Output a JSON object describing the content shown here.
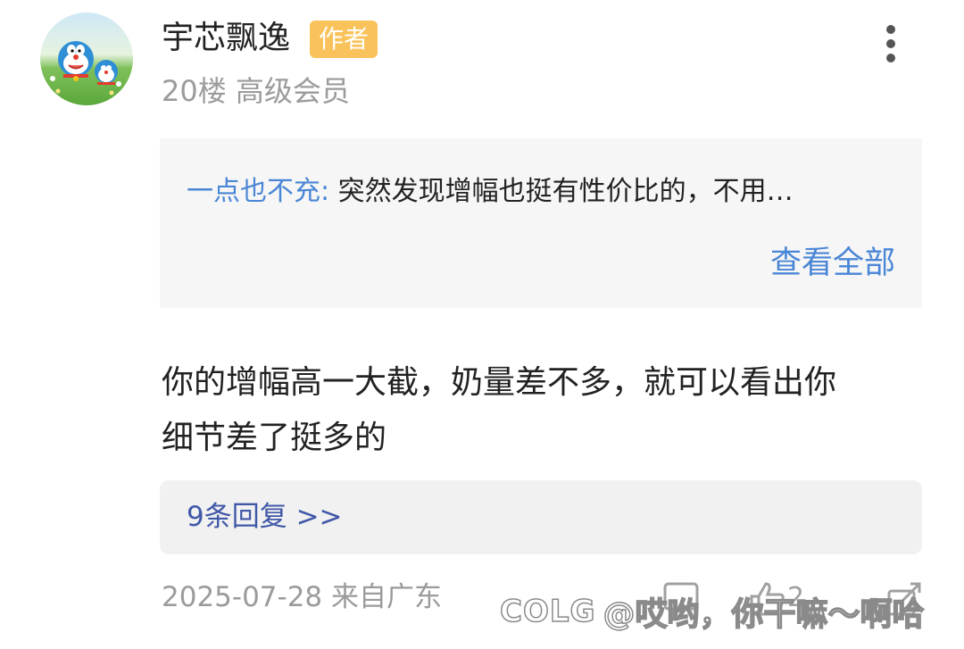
{
  "post": {
    "username": "宇芯飘逸",
    "author_badge": "作者",
    "floor": "20楼",
    "member_level": "高级会员",
    "quote": {
      "author": "一点也不充:",
      "text": " 突然发现增幅也挺有性价比的，不用…",
      "view_all_label": "查看全部"
    },
    "comment_line1": "你的增幅高一大截，奶量差不多，就可以看出你",
    "comment_line2": "细节差了挺多的",
    "replies_label": "9条回复 >>",
    "date": "2025-07-28",
    "location": "来自广东",
    "like_count": "2"
  },
  "watermark": {
    "logo": "COLG",
    "text": "@哎哟，你干嘛～啊哈"
  },
  "icons": {
    "more": "more-vertical-icon",
    "comment": "comment-icon",
    "like": "thumb-up-icon",
    "share": "share-icon"
  },
  "colors": {
    "badge": "#f9c25a",
    "link_blue": "#4a86d6",
    "reply_link": "#4058a8",
    "quote_bg": "#f6f6f6",
    "reply_bg": "#f1f1f1",
    "muted_text": "#9b9b9b"
  }
}
